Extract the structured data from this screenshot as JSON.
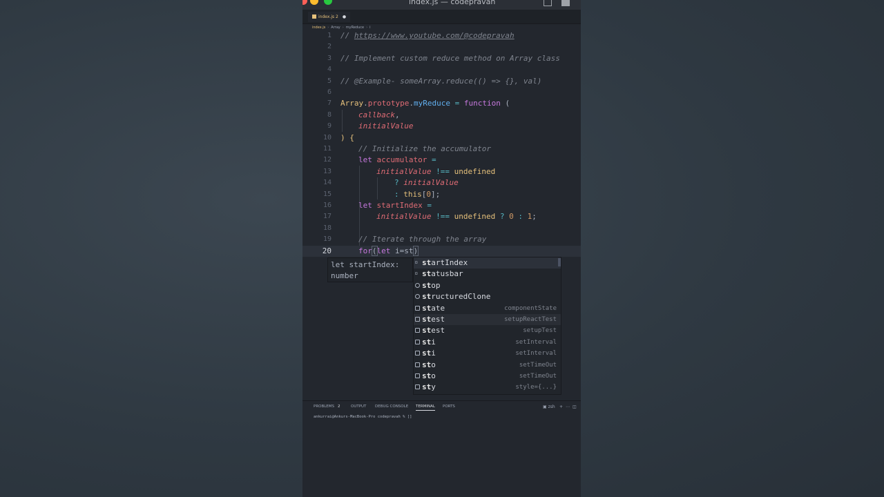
{
  "window": {
    "title": "index.js — codepravah"
  },
  "tab": {
    "label": "index.js",
    "problems": "2",
    "modified_dot": "●"
  },
  "breadcrumb": [
    "index.js",
    "Array",
    "myReduce",
    "i"
  ],
  "code_lines": [
    {
      "n": "1"
    },
    {
      "n": "2"
    },
    {
      "n": "3"
    },
    {
      "n": "4"
    },
    {
      "n": "5"
    },
    {
      "n": "6"
    },
    {
      "n": "7"
    },
    {
      "n": "8"
    },
    {
      "n": "9"
    },
    {
      "n": "10"
    },
    {
      "n": "11"
    },
    {
      "n": "12"
    },
    {
      "n": "13"
    },
    {
      "n": "14"
    },
    {
      "n": "15"
    },
    {
      "n": "16"
    },
    {
      "n": "17"
    },
    {
      "n": "18"
    },
    {
      "n": "19"
    },
    {
      "n": "20"
    }
  ],
  "code": {
    "l1": "// ",
    "l1_link": "https://www.youtube.com/@codepravah",
    "l3": "// Implement custom reduce method on Array class",
    "l5": "// @Example- someArray.reduce(() => {}, val)",
    "l7_a": "Array",
    "l7_b": ".",
    "l7_c": "prototype",
    "l7_d": ".",
    "l7_e": "myReduce",
    "l7_f": " = ",
    "l7_g": "function",
    "l7_h": " (",
    "l8": "callback",
    "l8_c": ",",
    "l9": "initialValue",
    "l10": ") {",
    "l11": "// Initialize the accumulator",
    "l12_a": "let",
    "l12_b": " accumulator",
    "l12_c": " =",
    "l13_a": "initialValue",
    "l13_b": " !==",
    "l13_c": " undefined",
    "l14_a": "? ",
    "l14_b": "initialValue",
    "l15_a": ": ",
    "l15_b": "this",
    "l15_c": "[",
    "l15_d": "0",
    "l15_e": "];",
    "l16_a": "let",
    "l16_b": " startIndex",
    "l16_c": " =",
    "l17_a": "initialValue",
    "l17_b": " !==",
    "l17_c": " undefined",
    "l17_d": " ? ",
    "l17_e": "0",
    "l17_f": " : ",
    "l17_g": "1",
    "l17_h": ";",
    "l19": "// Iterate through the array",
    "l20_a": "for",
    "l20_b": "(",
    "l20_c": "let",
    "l20_d": " i=st",
    "l20_e": ")"
  },
  "hover": {
    "line1": "let startIndex:",
    "line2": "number"
  },
  "suggestions": [
    {
      "match": "st",
      "rest": "artIndex",
      "detail": "",
      "kind": "variable"
    },
    {
      "match": "st",
      "rest": "atusbar",
      "detail": "",
      "kind": "variable"
    },
    {
      "match": "st",
      "rest": "op",
      "detail": "",
      "kind": "method"
    },
    {
      "match": "st",
      "rest": "ructuredClone",
      "detail": "",
      "kind": "method"
    },
    {
      "match": "st",
      "rest": "ate",
      "detail": "componentState",
      "kind": "snippet"
    },
    {
      "match": "st",
      "rest": "est",
      "detail": "setupReactTest",
      "kind": "snippet"
    },
    {
      "match": "st",
      "rest": "est",
      "detail": "setupTest",
      "kind": "snippet"
    },
    {
      "match": "st",
      "rest": "i",
      "detail": "setInterval",
      "kind": "snippet"
    },
    {
      "match": "st",
      "rest": "i",
      "detail": "setInterval",
      "kind": "snippet"
    },
    {
      "match": "st",
      "rest": "o",
      "detail": "setTimeOut",
      "kind": "snippet"
    },
    {
      "match": "st",
      "rest": "o",
      "detail": "setTimeOut",
      "kind": "snippet"
    },
    {
      "match": "st",
      "rest": "y",
      "detail": "style={...}",
      "kind": "snippet"
    }
  ],
  "panel": {
    "tabs": [
      "PROBLEMS",
      "OUTPUT",
      "DEBUG CONSOLE",
      "TERMINAL",
      "PORTS"
    ],
    "problems_count": "2",
    "shell": "zsh",
    "terminal_prompt": "ankurrai@Ankurs-MacBook-Pro codepravah % []"
  },
  "colors": {
    "editor_bg": "#23272e",
    "comment": "#7f848e",
    "keyword": "#c678dd",
    "class": "#e5c07b",
    "function": "#61afef",
    "param": "#e06c75"
  }
}
